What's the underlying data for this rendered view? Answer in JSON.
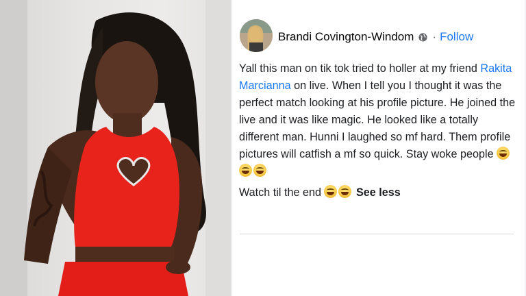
{
  "photo": {
    "description_icon": "person-photo"
  },
  "post": {
    "author": "Brandi Covington-Windom",
    "separator": "·",
    "follow_label": "Follow",
    "text_before_mention": "Yall this man on tik tok tried to holler at my friend ",
    "mention": "Rakita Marcianna",
    "text_after_mention": " on live. When I tell you I thought it was the perfect match looking at his profile picture. He joined the live and it was like magic. He looked like a totally different man. Hunni I laughed so mf hard. Them profile pictures will catfish a mf so quick.  Stay woke people ",
    "line2_text": "Watch til the end ",
    "see_less_label": "See less"
  },
  "colors": {
    "link": "#1877f2",
    "text": "#1c1e21",
    "dress": "#e8231c"
  }
}
